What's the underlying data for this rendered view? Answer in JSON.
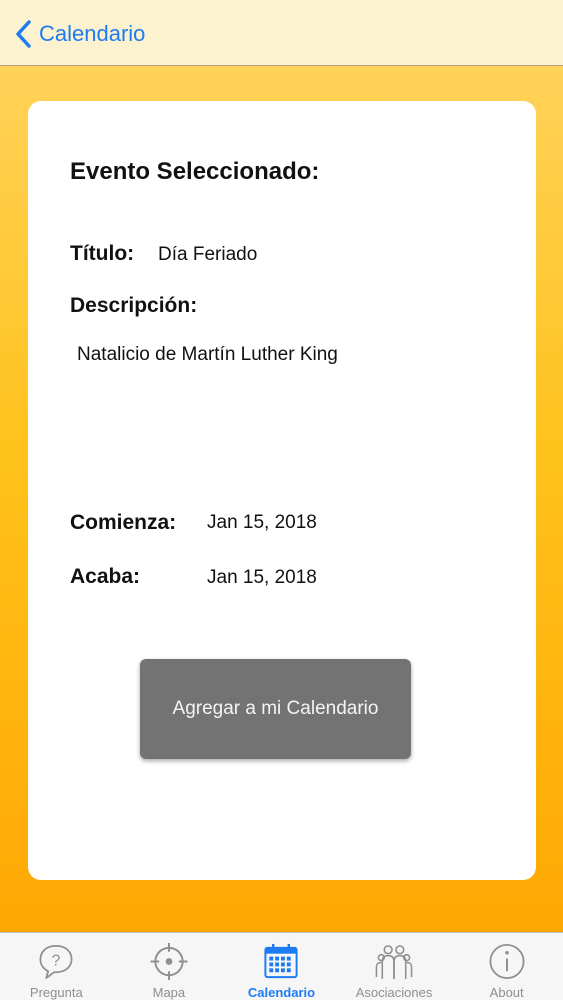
{
  "navbar": {
    "back_label": "Calendario",
    "back_icon": "chevron-left-icon",
    "accent_color": "#1e7cf3"
  },
  "event": {
    "heading": "Evento Seleccionado:",
    "title_label": "Título:",
    "title_value": "Día Feriado",
    "description_label": "Descripción:",
    "description_value": "Natalicio de Martín Luther King",
    "start_label": "Comienza:",
    "start_value": "Jan 15, 2018",
    "end_label": "Acaba:",
    "end_value": "Jan 15, 2018",
    "add_button_label": "Agregar a mi Calendario"
  },
  "tabs": [
    {
      "label": "Pregunta",
      "icon": "question-bubble-icon",
      "active": false
    },
    {
      "label": "Mapa",
      "icon": "crosshair-icon",
      "active": false
    },
    {
      "label": "Calendario",
      "icon": "calendar-icon",
      "active": true
    },
    {
      "label": "Asociaciones",
      "icon": "group-icon",
      "active": false
    },
    {
      "label": "About",
      "icon": "info-icon",
      "active": false
    }
  ]
}
